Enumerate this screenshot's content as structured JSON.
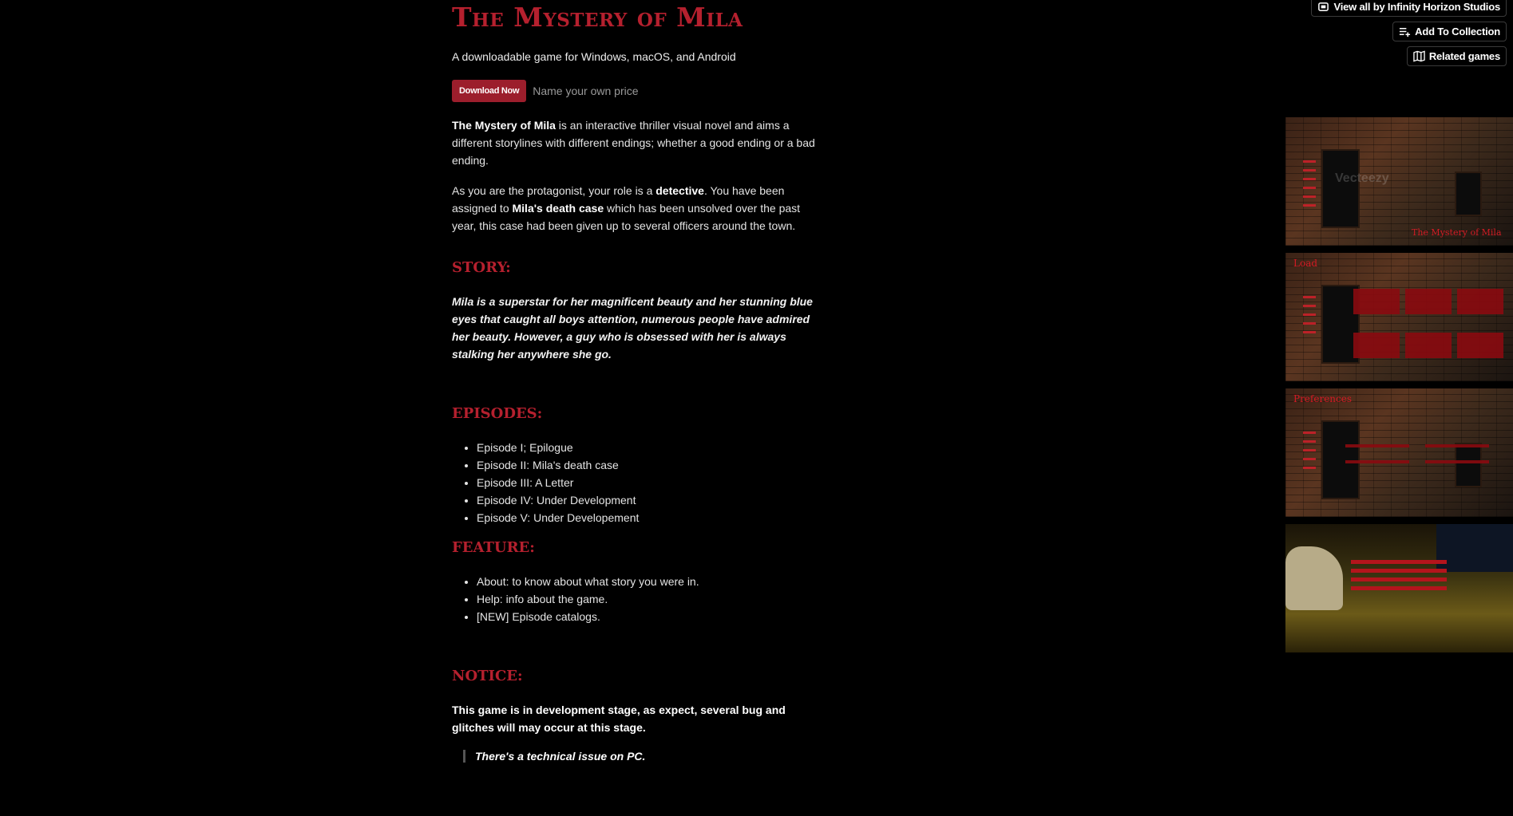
{
  "top_actions": {
    "view_all": "View all by Infinity Horizon Studios",
    "add_collection": "Add To Collection",
    "related_games": "Related games"
  },
  "header": {
    "title": "The Mystery of Mila",
    "subtitle": "A downloadable game for Windows, macOS, and Android"
  },
  "buy": {
    "download_label": "Download Now",
    "price_hint": "Name your own price"
  },
  "intro": {
    "p1_bold": "The Mystery of Mila",
    "p1_rest": " is an interactive thriller visual novel and aims a different storylines with different endings; whether a good ending or a bad ending.",
    "p2_a": "As you are the protagonist, your role is a ",
    "p2_bold1": "detective",
    "p2_b": ". You have been assigned to ",
    "p2_bold2": "Mila's death case",
    "p2_c": " which has been unsolved over the past year, this case had been given up to several officers around the town."
  },
  "story": {
    "heading": "STORY:",
    "text": "Mila is a superstar for her magnificent beauty and her stunning blue eyes that caught all boys attention, numerous people have admired her beauty. However, a guy who is obsessed with her is always stalking her anywhere she go."
  },
  "episodes": {
    "heading": "EPISODES:",
    "items": [
      "Episode I; Epilogue",
      "Episode II: Mila's death case",
      "Episode III: A Letter",
      "Episode IV: Under Development",
      "Episode V: Under Developement"
    ]
  },
  "feature": {
    "heading": "FEATURE:",
    "items": [
      "About: to know about what story you were in.",
      "Help: info about the game.",
      "[NEW] Episode catalogs."
    ]
  },
  "notice": {
    "heading": "NOTICE:",
    "text": "This game is in development stage, as expect, several bug and glitches will may occur at this stage.",
    "quote": "There's a technical issue on PC."
  },
  "screenshots": {
    "shot1_caption": "The Mystery of Mila",
    "shot2_caption": "Load",
    "shot3_caption": "Preferences",
    "watermark": "Vecteezy"
  }
}
